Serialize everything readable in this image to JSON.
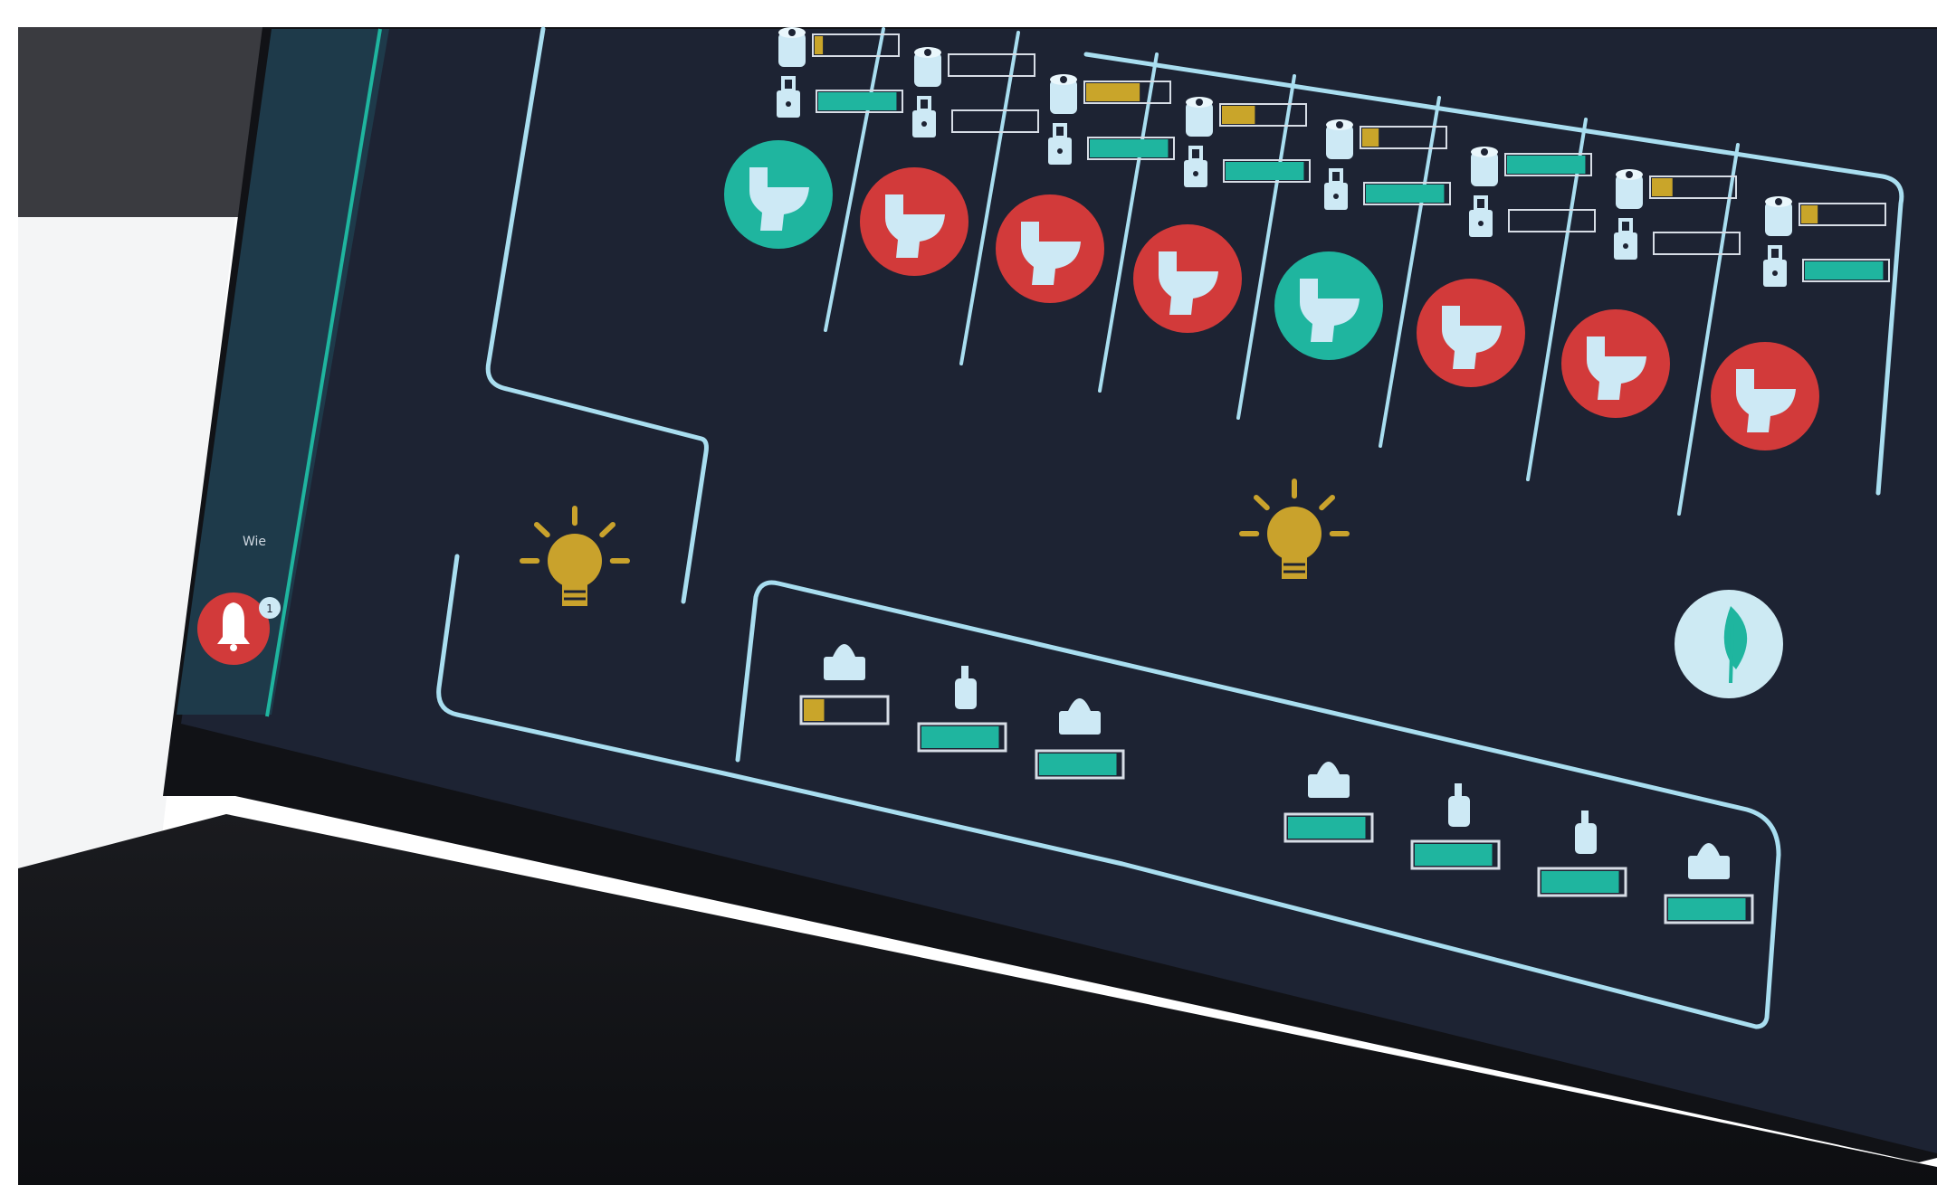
{
  "theme": {
    "screen_bg": "#1d2333",
    "line": "#a9def0",
    "ok": "#1fb59f",
    "alert": "#d23a3a",
    "level_high": "#1fb59f",
    "level_mid": "#c9a52a",
    "level_empty_frame": "#d7dde6",
    "bulb": "#c9a22c",
    "icon_light": "#cde9f5"
  },
  "sidebar": {
    "label": "Wie",
    "alert_button": {
      "icon": "bell-icon",
      "status": "alert",
      "badge": "1"
    }
  },
  "cubicles": [
    {
      "id": 1,
      "status": "ok",
      "paper_level": 0.1,
      "soap_level": 0.95
    },
    {
      "id": 2,
      "status": "alert",
      "paper_level": 0.0,
      "soap_level": 0.0
    },
    {
      "id": 3,
      "status": "alert",
      "paper_level": 0.65,
      "soap_level": 0.95
    },
    {
      "id": 4,
      "status": "alert",
      "paper_level": 0.4,
      "soap_level": 0.95
    },
    {
      "id": 5,
      "status": "ok",
      "paper_level": 0.2,
      "soap_level": 0.95
    },
    {
      "id": 6,
      "status": "alert",
      "paper_level": 0.95,
      "soap_level": 0.0
    },
    {
      "id": 7,
      "status": "alert",
      "paper_level": 0.25,
      "soap_level": 0.0
    },
    {
      "id": 8,
      "status": "alert",
      "paper_level": 0.2,
      "soap_level": 0.95
    }
  ],
  "lights": [
    {
      "id": "left",
      "icon": "lightbulb-icon",
      "state": "on"
    },
    {
      "id": "right",
      "icon": "lightbulb-icon",
      "state": "on"
    }
  ],
  "eco_button": {
    "icon": "leaf-icon"
  },
  "sink_dispensers": [
    {
      "type": "towel",
      "level": 0.25
    },
    {
      "type": "soap",
      "level": 0.95
    },
    {
      "type": "towel",
      "level": 0.95
    },
    {
      "type": "towel",
      "level": 0.95
    },
    {
      "type": "soap",
      "level": 0.95
    },
    {
      "type": "soap",
      "level": 0.95
    },
    {
      "type": "towel",
      "level": 0.95
    }
  ]
}
